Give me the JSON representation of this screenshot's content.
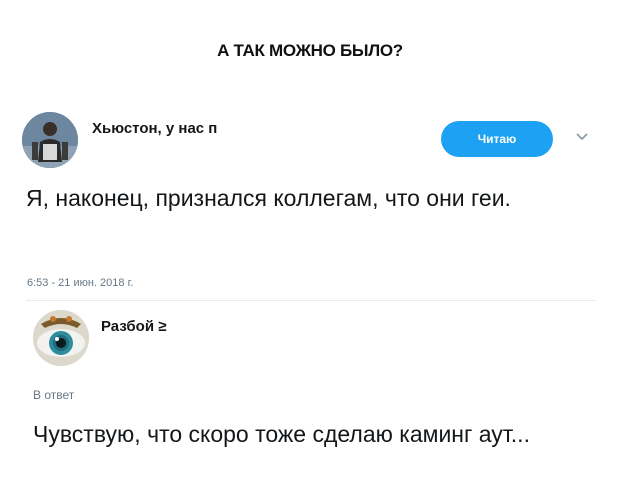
{
  "headline": "А ТАК МОЖНО БЫЛО?",
  "tweet": {
    "author_name": "Хьюстон, у нас п",
    "follow_label": "Читаю",
    "text": "Я, наконец, признался коллегам, что они геи.",
    "timestamp": "6:53 - 21 июн. 2018 г."
  },
  "reply": {
    "author_name": "Разбой ≥",
    "reply_label": "В ответ",
    "text": "Чувствую, что скоро тоже сделаю каминг аут..."
  },
  "icons": {
    "caret": "chevron-down-icon"
  },
  "colors": {
    "accent": "#1da1f2",
    "muted": "#657786",
    "text": "#14171a"
  }
}
